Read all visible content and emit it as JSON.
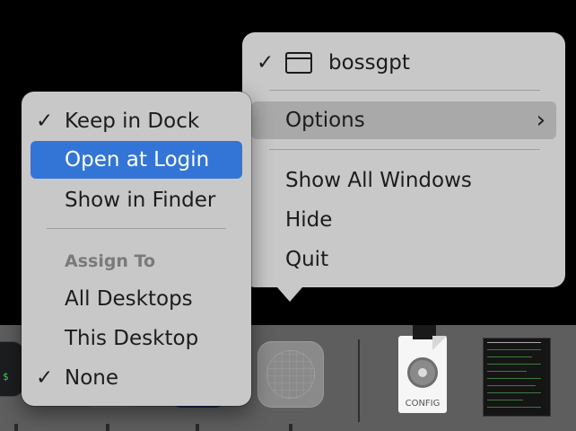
{
  "app_menu": {
    "title": "bossgpt",
    "items": [
      "Options",
      "Show All Windows",
      "Hide",
      "Quit"
    ],
    "chevron": "›"
  },
  "options_menu": {
    "items": [
      "Keep in Dock",
      "Open at Login",
      "Show in Finder"
    ],
    "section_header": "Assign To",
    "assign_items": [
      "All Desktops",
      "This Desktop",
      "None"
    ],
    "check": "✓"
  },
  "dock": {
    "file_label": "CONFIG",
    "terminal_prompt": "$"
  },
  "icons": {
    "window": "window-icon",
    "checkmark": "checkmark-icon",
    "chevron": "chevron-right-icon",
    "gear": "gear-icon"
  },
  "colors": {
    "selection": "#3375d6",
    "menu_bg": "#c8c8c8",
    "dock_bg": "#5e5e5e"
  }
}
